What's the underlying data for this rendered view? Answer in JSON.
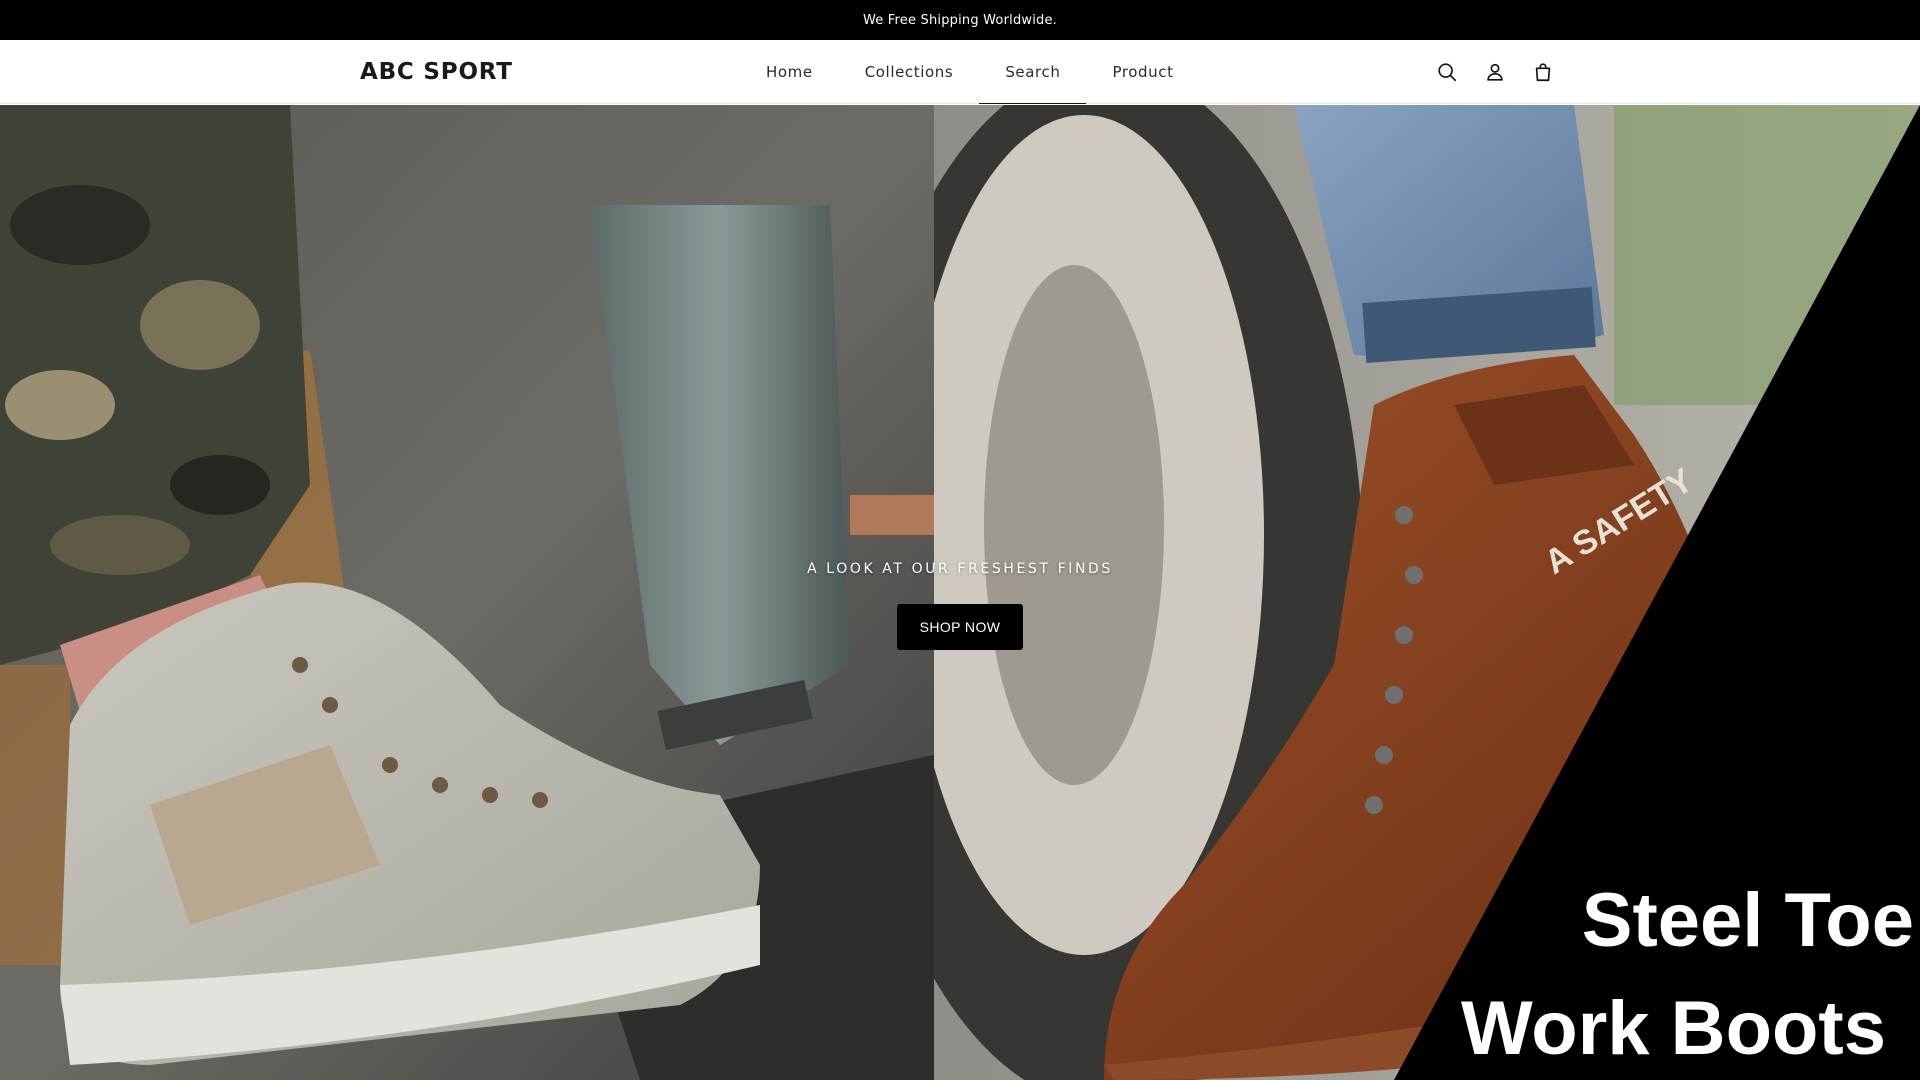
{
  "announcement": {
    "text": "We Free Shipping Worldwide."
  },
  "header": {
    "logo": "ABC SPORT",
    "nav": [
      {
        "label": "Home"
      },
      {
        "label": "Collections"
      },
      {
        "label": "Search"
      },
      {
        "label": "Product"
      }
    ],
    "active_nav": "Search",
    "icons": [
      "search-icon",
      "account-icon",
      "cart-icon"
    ]
  },
  "hero": {
    "subheading": "A LOOK AT OUR FRESHEST FINDS",
    "button_label": "SHOP NOW",
    "promo_line1": "Steel Toe",
    "promo_line2": "Work Boots",
    "boot_brand_text": "A SAFETY"
  },
  "colors": {
    "announcement_bg": "#000000",
    "button_bg": "#000000",
    "text_primary": "#121212"
  }
}
